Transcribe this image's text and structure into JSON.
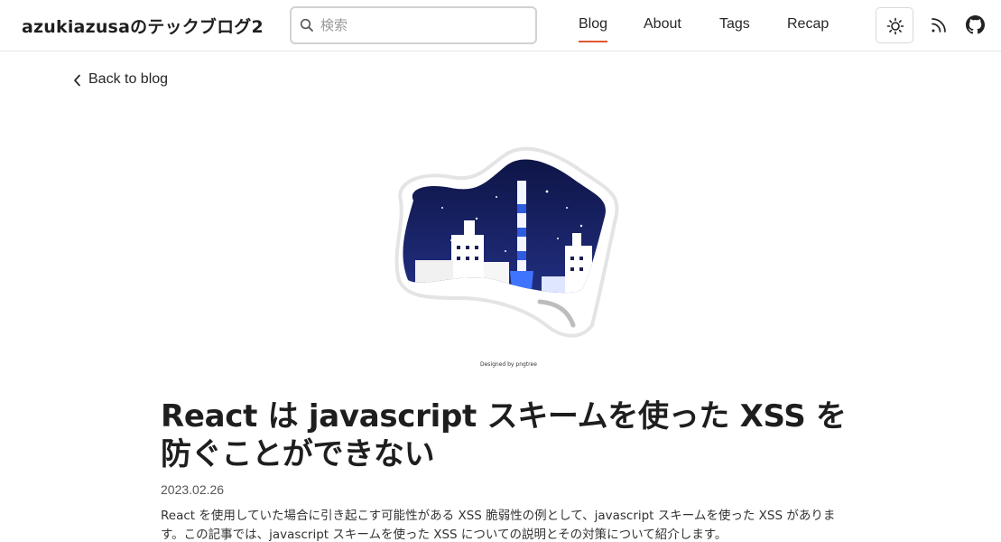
{
  "header": {
    "site_title": "azukiazusaのテックブログ2",
    "search": {
      "placeholder": "検索",
      "value": ""
    },
    "nav": [
      {
        "label": "Blog",
        "active": true
      },
      {
        "label": "About",
        "active": false
      },
      {
        "label": "Tags",
        "active": false
      },
      {
        "label": "Recap",
        "active": false
      }
    ],
    "icons": [
      "search-icon",
      "sun-icon",
      "rss-icon",
      "github-icon"
    ],
    "accent_color": "#e4572e"
  },
  "back_link": {
    "label": "Back to blog",
    "icon": "chevron-left-icon"
  },
  "hero_image": {
    "credit": "Designed by pngtree"
  },
  "post": {
    "title": "React は javascript スキームを使った XSS を防ぐことができない",
    "date": "2023.02.26",
    "summary": "React を使用していた場合に引き起こす可能性がある XSS 脆弱性の例として、javascript スキームを使った XSS があります。この記事では、javascript スキームを使った XSS についての説明とその対策について紹介します。"
  }
}
